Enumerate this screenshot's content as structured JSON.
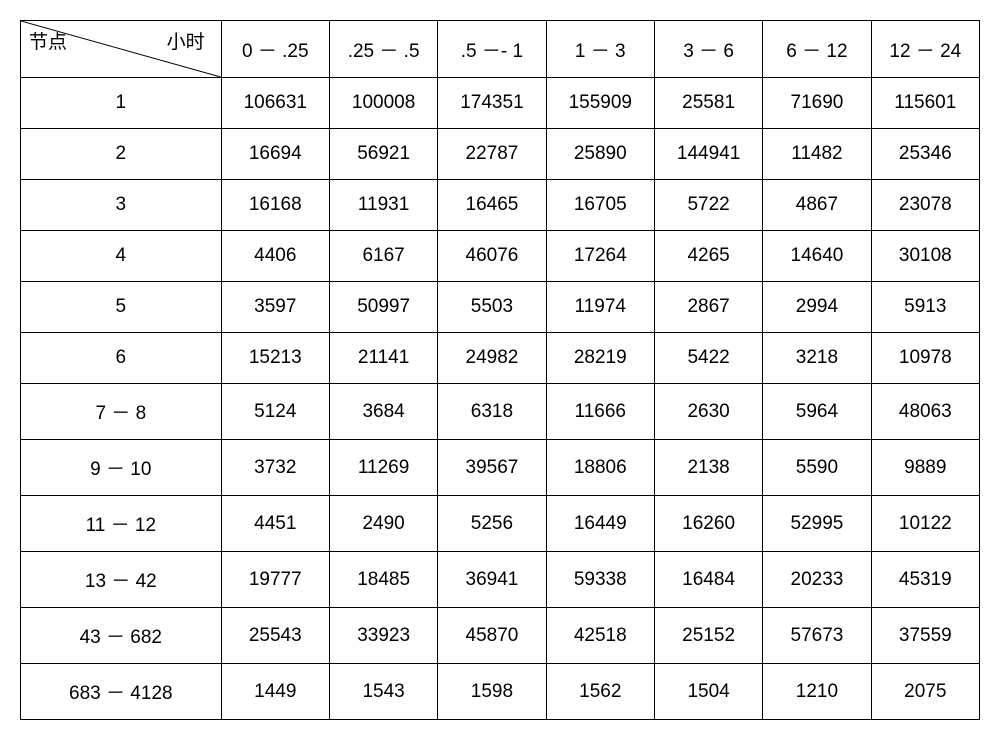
{
  "chart_data": {
    "type": "table",
    "corner": {
      "row_label": "节点",
      "col_label": "小时"
    },
    "columns": [
      "0 － .25",
      ".25 － .5",
      ".5 －- 1",
      "1 － 3",
      "3 － 6",
      "6 － 12",
      "12 － 24"
    ],
    "rows": [
      {
        "label": "1",
        "values": [
          106631,
          100008,
          174351,
          155909,
          25581,
          71690,
          115601
        ]
      },
      {
        "label": "2",
        "values": [
          16694,
          56921,
          22787,
          25890,
          144941,
          11482,
          25346
        ]
      },
      {
        "label": "3",
        "values": [
          16168,
          11931,
          16465,
          16705,
          5722,
          4867,
          23078
        ]
      },
      {
        "label": "4",
        "values": [
          4406,
          6167,
          46076,
          17264,
          4265,
          14640,
          30108
        ]
      },
      {
        "label": "5",
        "values": [
          3597,
          50997,
          5503,
          11974,
          2867,
          2994,
          5913
        ]
      },
      {
        "label": "6",
        "values": [
          15213,
          21141,
          24982,
          28219,
          5422,
          3218,
          10978
        ]
      },
      {
        "label": "7 － 8",
        "values": [
          5124,
          3684,
          6318,
          11666,
          2630,
          5964,
          48063
        ]
      },
      {
        "label": "9 － 10",
        "values": [
          3732,
          11269,
          39567,
          18806,
          2138,
          5590,
          9889
        ]
      },
      {
        "label": "11 － 12",
        "values": [
          4451,
          2490,
          5256,
          16449,
          16260,
          52995,
          10122
        ]
      },
      {
        "label": "13 － 42",
        "values": [
          19777,
          18485,
          36941,
          59338,
          16484,
          20233,
          45319
        ]
      },
      {
        "label": "43 － 682",
        "values": [
          25543,
          33923,
          45870,
          42518,
          25152,
          57673,
          37559
        ]
      },
      {
        "label": "683 － 4128",
        "values": [
          1449,
          1543,
          1598,
          1562,
          1504,
          1210,
          2075
        ]
      }
    ]
  }
}
